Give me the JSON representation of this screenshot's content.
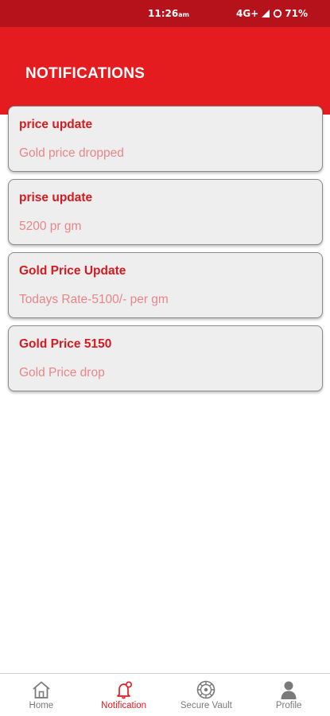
{
  "status_bar": {
    "time": "11:26",
    "ampm": "am",
    "network": "4G+",
    "battery": "71%"
  },
  "header": {
    "title": "NOTIFICATIONS"
  },
  "notifications": [
    {
      "title": "price update",
      "message": "Gold price dropped"
    },
    {
      "title": "prise update",
      "message": "5200 pr gm"
    },
    {
      "title": "Gold Price Update",
      "message": "Todays Rate-5100/- per gm"
    },
    {
      "title": "Gold Price 5150",
      "message": "Gold Price drop"
    }
  ],
  "bottom_nav": {
    "items": [
      {
        "label": "Home",
        "icon": "home-icon"
      },
      {
        "label": "Notification",
        "icon": "bell-icon",
        "active": true
      },
      {
        "label": "Secure Vault",
        "icon": "vault-icon"
      },
      {
        "label": "Profile",
        "icon": "person-icon"
      }
    ]
  },
  "colors": {
    "status_bar": "#b5121b",
    "header": "#e41b1f",
    "title_text": "#d71920",
    "message_text": "#e8858a",
    "nav_inactive": "#7a7a7a"
  }
}
